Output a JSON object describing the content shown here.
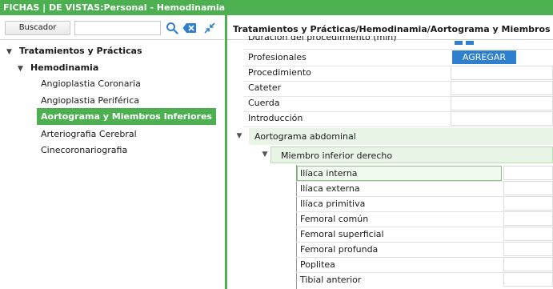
{
  "titlebar": {
    "text": "FICHAS | DE VISTAS:Personal - Hemodinamia"
  },
  "left": {
    "search_button": "Buscador",
    "search_value": "",
    "tree": {
      "root": "Tratamientos y Prácticas",
      "group": "Hemodinamia",
      "items": [
        "Angioplastia Coronaria",
        "Angioplastia Periférica",
        "Aortograma y Miembros Inferiores",
        "Arteriografia Cerebral",
        "Cinecoronariografia"
      ],
      "selected_index": 2
    }
  },
  "right": {
    "breadcrumb": "Tratamientos y Prácticas/Hemodinamia/Aortograma y Miembros Inferiores",
    "fields": [
      {
        "label": "Duración del procedimiento (min)"
      },
      {
        "label": "Profesionales"
      },
      {
        "label": "Procedimiento"
      },
      {
        "label": "Cateter"
      },
      {
        "label": "Cuerda"
      },
      {
        "label": "Introducción"
      }
    ],
    "add_button": "AGREGAR",
    "section": "Aortograma abdominal",
    "subsection": "Miembro inferior derecho",
    "sub_fields": [
      "Ilíaca interna",
      "Ilíaca externa",
      "Ilíaca primitiva",
      "Femoral común",
      "Femoral superficial",
      "Femoral profunda",
      "Poplitea",
      "Tibial anterior"
    ]
  },
  "colors": {
    "accent": "#4caf50",
    "button_blue": "#2e7fd0",
    "group_bg": "#e8f5e6"
  }
}
